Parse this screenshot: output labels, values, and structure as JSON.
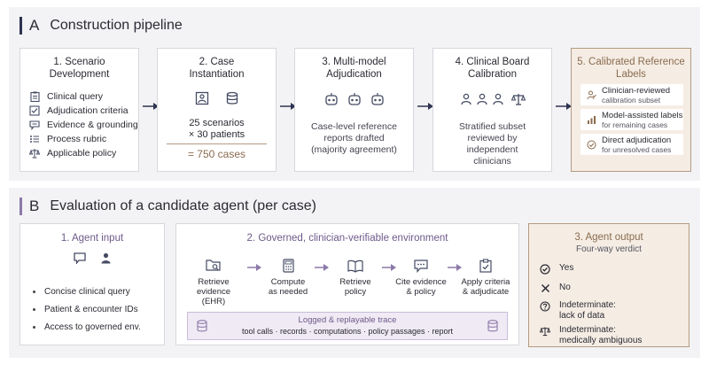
{
  "colors": {
    "accent_a": "#2e3350",
    "accent_b": "#8b79a8",
    "highlight_border": "#b39a82",
    "highlight_bg": "#f5ede4",
    "purple_text": "#6e5a8a",
    "brown_text": "#8a6b4e",
    "icon": "#454b63"
  },
  "sectionA": {
    "letter": "A",
    "title": "Construction pipeline",
    "box1": {
      "title_l1": "1. Scenario",
      "title_l2": "Development",
      "items": [
        {
          "icon": "clipboard-icon",
          "label": "Clinical query"
        },
        {
          "icon": "checklist-icon",
          "label": "Adjudication criteria"
        },
        {
          "icon": "speech-bubble-icon",
          "label": "Evidence & grounding"
        },
        {
          "icon": "list-icon",
          "label": "Process rubric"
        },
        {
          "icon": "scales-icon",
          "label": "Applicable policy"
        }
      ]
    },
    "box2": {
      "title_l1": "2. Case",
      "title_l2": "Instantiation",
      "line1": "25 scenarios",
      "line2": "× 30 patients",
      "total": "= 750 cases"
    },
    "box3": {
      "title_l1": "3. Multi-model",
      "title_l2": "Adjudication",
      "line1": "Case-level reference",
      "line2": "reports drafted",
      "line3": "(majority agreement)"
    },
    "box4": {
      "title_l1": "4. Clinical Board",
      "title_l2": "Calibration",
      "line1": "Stratified subset",
      "line2": "reviewed by",
      "line3": "independent",
      "line4": "clinicians"
    },
    "box5": {
      "title_l1": "5. Calibrated Reference",
      "title_l2": "Labels",
      "items": [
        {
          "icon": "person-check-icon",
          "title": "Clinician-reviewed",
          "sub": "calibration subset"
        },
        {
          "icon": "bar-chart-icon",
          "title": "Model-assisted labels",
          "sub": "for remaining cases"
        },
        {
          "icon": "check-circle-icon",
          "title": "Direct adjudication",
          "sub": "for unresolved cases"
        }
      ]
    }
  },
  "sectionB": {
    "letter": "B",
    "title": "Evaluation of a candidate agent (per case)",
    "input": {
      "title": "1. Agent input",
      "bullets": [
        "Concise clinical query",
        "Patient & encounter IDs",
        "Access to governed env."
      ]
    },
    "env": {
      "title": "2. Governed, clinician-verifiable environment",
      "steps": [
        {
          "icon": "folder-search-icon",
          "l1": "Retrieve",
          "l2": "evidence (EHR)"
        },
        {
          "icon": "calculator-icon",
          "l1": "Compute",
          "l2": "as needed"
        },
        {
          "icon": "book-icon",
          "l1": "Retrieve",
          "l2": "policy"
        },
        {
          "icon": "quote-bubble-icon",
          "l1": "Cite evidence",
          "l2": "& policy"
        },
        {
          "icon": "clipboard-check-icon",
          "l1": "Apply criteria",
          "l2": "& adjudicate"
        }
      ],
      "trace_title": "Logged & replayable trace",
      "trace_sub": "tool calls · records · computations · policy passages · report"
    },
    "output": {
      "title": "3. Agent output",
      "subtitle": "Four-way verdict",
      "verdicts": [
        {
          "icon": "check-circle-icon",
          "l1": "Yes",
          "l2": ""
        },
        {
          "icon": "x-icon",
          "l1": "No",
          "l2": ""
        },
        {
          "icon": "question-circle-icon",
          "l1": "Indeterminate:",
          "l2": "lack of data"
        },
        {
          "icon": "scales-icon",
          "l1": "Indeterminate:",
          "l2": "medically ambiguous"
        }
      ]
    }
  }
}
